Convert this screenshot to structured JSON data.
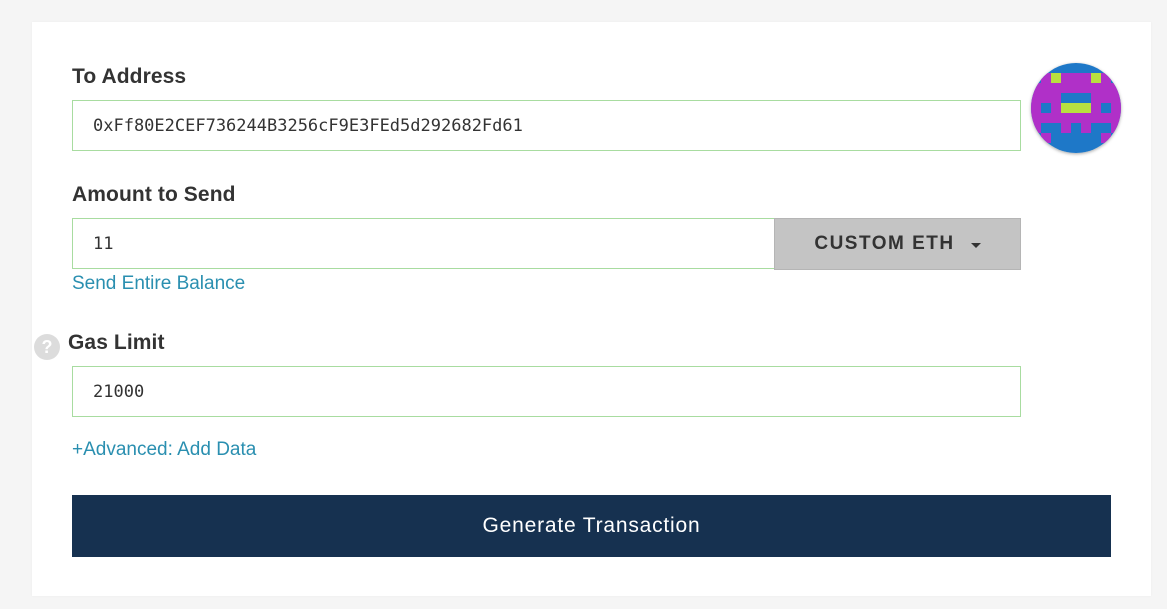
{
  "form": {
    "to_address_label": "To Address",
    "to_address_value": "0xFf80E2CEF736244B3256cF9E3FEd5d292682Fd61",
    "amount_label": "Amount to Send",
    "amount_value": "11",
    "unit_selected": "CUSTOM ETH",
    "send_entire_balance": "Send Entire Balance",
    "gas_limit_label": "Gas Limit",
    "gas_limit_value": "21000",
    "advanced_link": "+Advanced: Add Data",
    "generate_button": "Generate Transaction",
    "help_glyph": "?"
  },
  "icons": {
    "help": "help-icon",
    "caret": "caret-down-icon",
    "identicon": "identicon-avatar"
  },
  "colors": {
    "field_border": "#a8dca0",
    "link": "#2a8fb0",
    "button_bg": "#163150",
    "dropdown_bg": "#c4c4c4",
    "identicon_bg": "#1e78c8",
    "identicon_primary": "#b030c8",
    "identicon_spot": "#b8e040"
  }
}
